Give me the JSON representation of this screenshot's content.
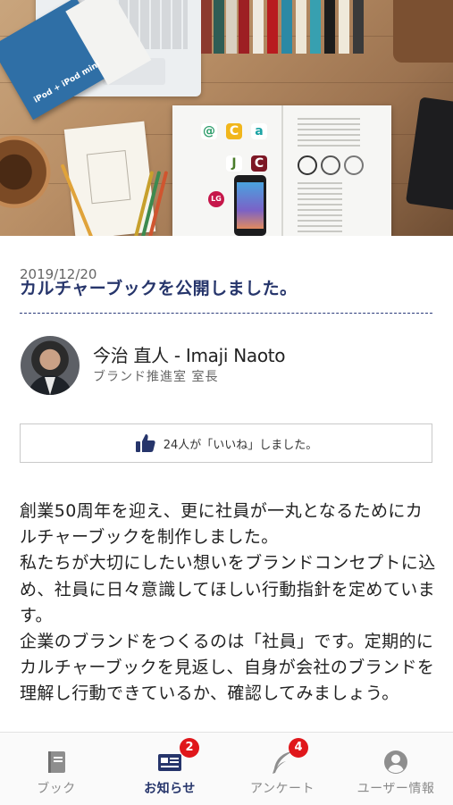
{
  "article": {
    "date": "2019/12/20",
    "title": "カルチャーブックを公開しました。",
    "author_name": "今治 直人 - Imaji Naoto",
    "author_role": "ブランド推進室 室長",
    "likes_text": "24人が「いいね」しました。",
    "body": [
      "創業50周年を迎え、更に社員が一丸となるためにカルチャーブックを制作しました。",
      "私たちが大切にしたい想いをブランドコンセプトに込め、社員に日々意識してほしい行動指針を定めています。",
      "企業のブランドをつくるのは「社員」です。定期的にカルチャーブックを見返し、自身が会社のブランドを理解し行動できているか、確認してみましょう。"
    ]
  },
  "hero": {
    "booklet_text": "iPod + iPod mini",
    "logo_glyphs": [
      "@",
      "C",
      "a",
      "J",
      "C",
      "LG"
    ]
  },
  "tabbar": {
    "tabs": [
      {
        "label": "ブック",
        "icon": "book-icon",
        "badge": ""
      },
      {
        "label": "お知らせ",
        "icon": "news-icon",
        "badge": "2"
      },
      {
        "label": "アンケート",
        "icon": "quill-icon",
        "badge": "4"
      },
      {
        "label": "ユーザー情報",
        "icon": "user-circle-icon",
        "badge": ""
      }
    ],
    "active_index": 1
  },
  "colors": {
    "brand_navy": "#26356b",
    "badge_red": "#e0171b",
    "inactive_gray": "#8a8a8a"
  }
}
